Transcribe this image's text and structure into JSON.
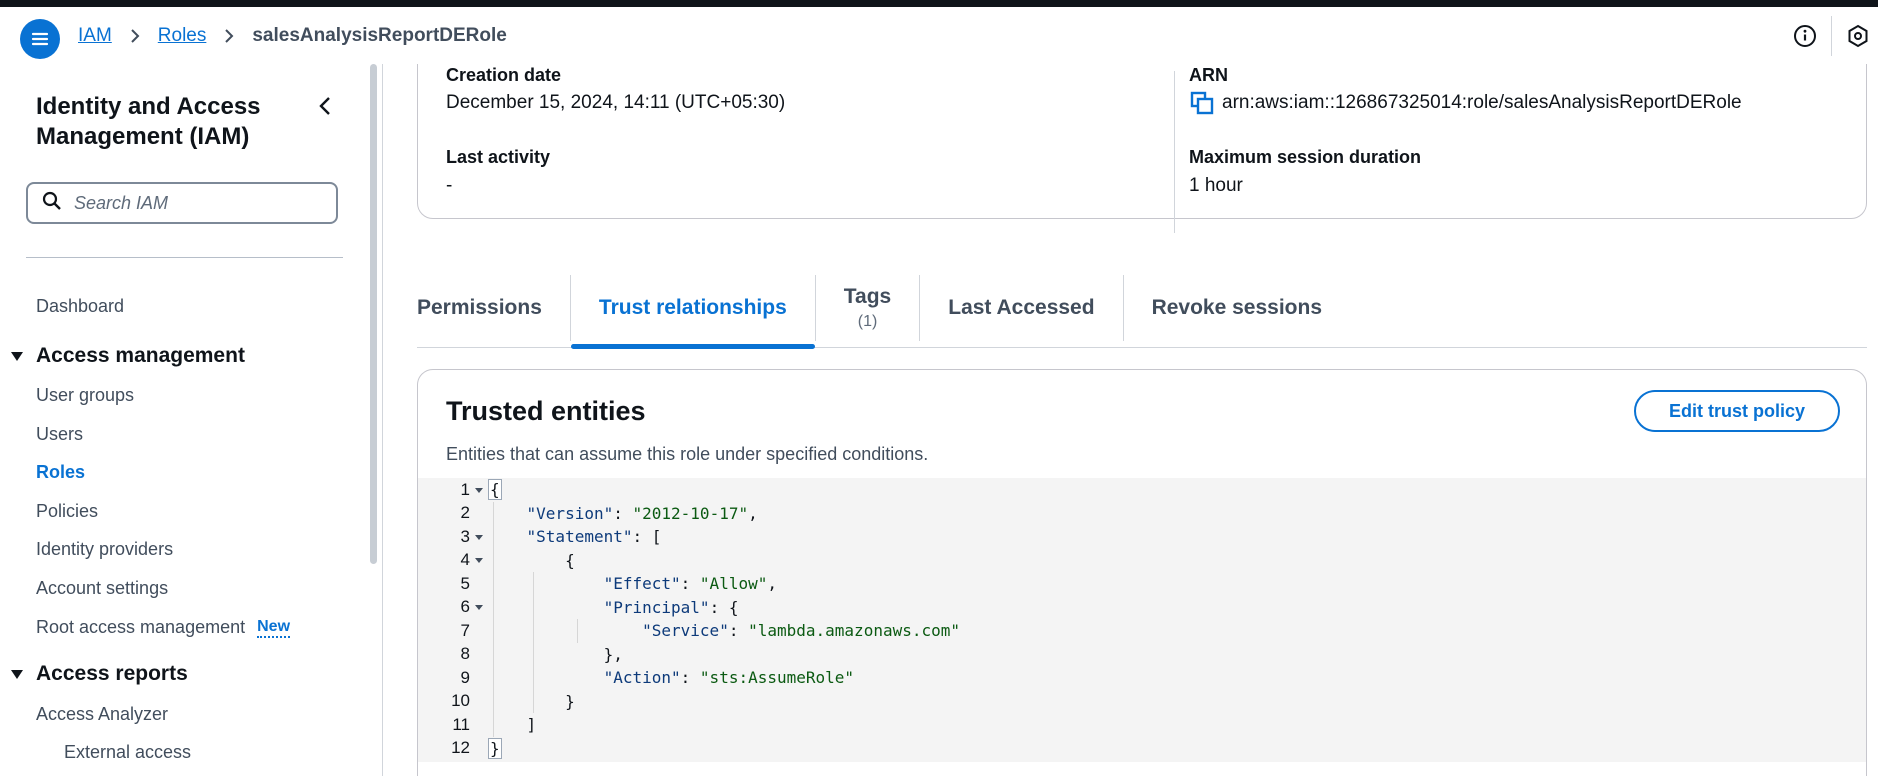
{
  "breadcrumb": {
    "items": [
      "IAM",
      "Roles"
    ],
    "current": "salesAnalysisReportDERole"
  },
  "sidebar": {
    "title": "Identity and Access Management (IAM)",
    "search_placeholder": "Search IAM",
    "dashboard": "Dashboard",
    "sections": [
      {
        "label": "Access management",
        "items": [
          "User groups",
          "Users",
          "Roles",
          "Policies",
          "Identity providers",
          "Account settings",
          "Root access management"
        ]
      },
      {
        "label": "Access reports",
        "items": [
          "Access Analyzer",
          "External access"
        ]
      }
    ],
    "active_item": "Roles",
    "new_badge": "New"
  },
  "summary": {
    "creation_date_label": "Creation date",
    "creation_date_value": "December 15, 2024, 14:11 (UTC+05:30)",
    "last_activity_label": "Last activity",
    "last_activity_value": "-",
    "arn_label": "ARN",
    "arn_value": "arn:aws:iam::126867325014:role/salesAnalysisReportDERole",
    "max_session_label": "Maximum session duration",
    "max_session_value": "1 hour"
  },
  "tabs": [
    {
      "label": "Permissions"
    },
    {
      "label": "Trust relationships",
      "active": true
    },
    {
      "label": "Tags",
      "count": "(1)"
    },
    {
      "label": "Last Accessed"
    },
    {
      "label": "Revoke sessions"
    }
  ],
  "trust": {
    "title": "Trusted entities",
    "description": "Entities that can assume this role under specified conditions.",
    "edit_button": "Edit trust policy",
    "code_lines": [
      "{",
      "    \"Version\": \"2012-10-17\",",
      "    \"Statement\": [",
      "        {",
      "            \"Effect\": \"Allow\",",
      "            \"Principal\": {",
      "                \"Service\": \"lambda.amazonaws.com\"",
      "            },",
      "            \"Action\": \"sts:AssumeRole\"",
      "        }",
      "    ]",
      "}"
    ],
    "foldable_lines": [
      1,
      3,
      4,
      6
    ]
  },
  "icons": {
    "menu": "hamburger-icon",
    "info": "info-icon",
    "settings": "hexagon-settings-icon",
    "collapse": "chevron-left-icon",
    "search": "search-icon",
    "copy": "copy-icon"
  },
  "colors": {
    "accent": "#0972d3",
    "text": "#0f141a",
    "muted": "#414d5c"
  }
}
